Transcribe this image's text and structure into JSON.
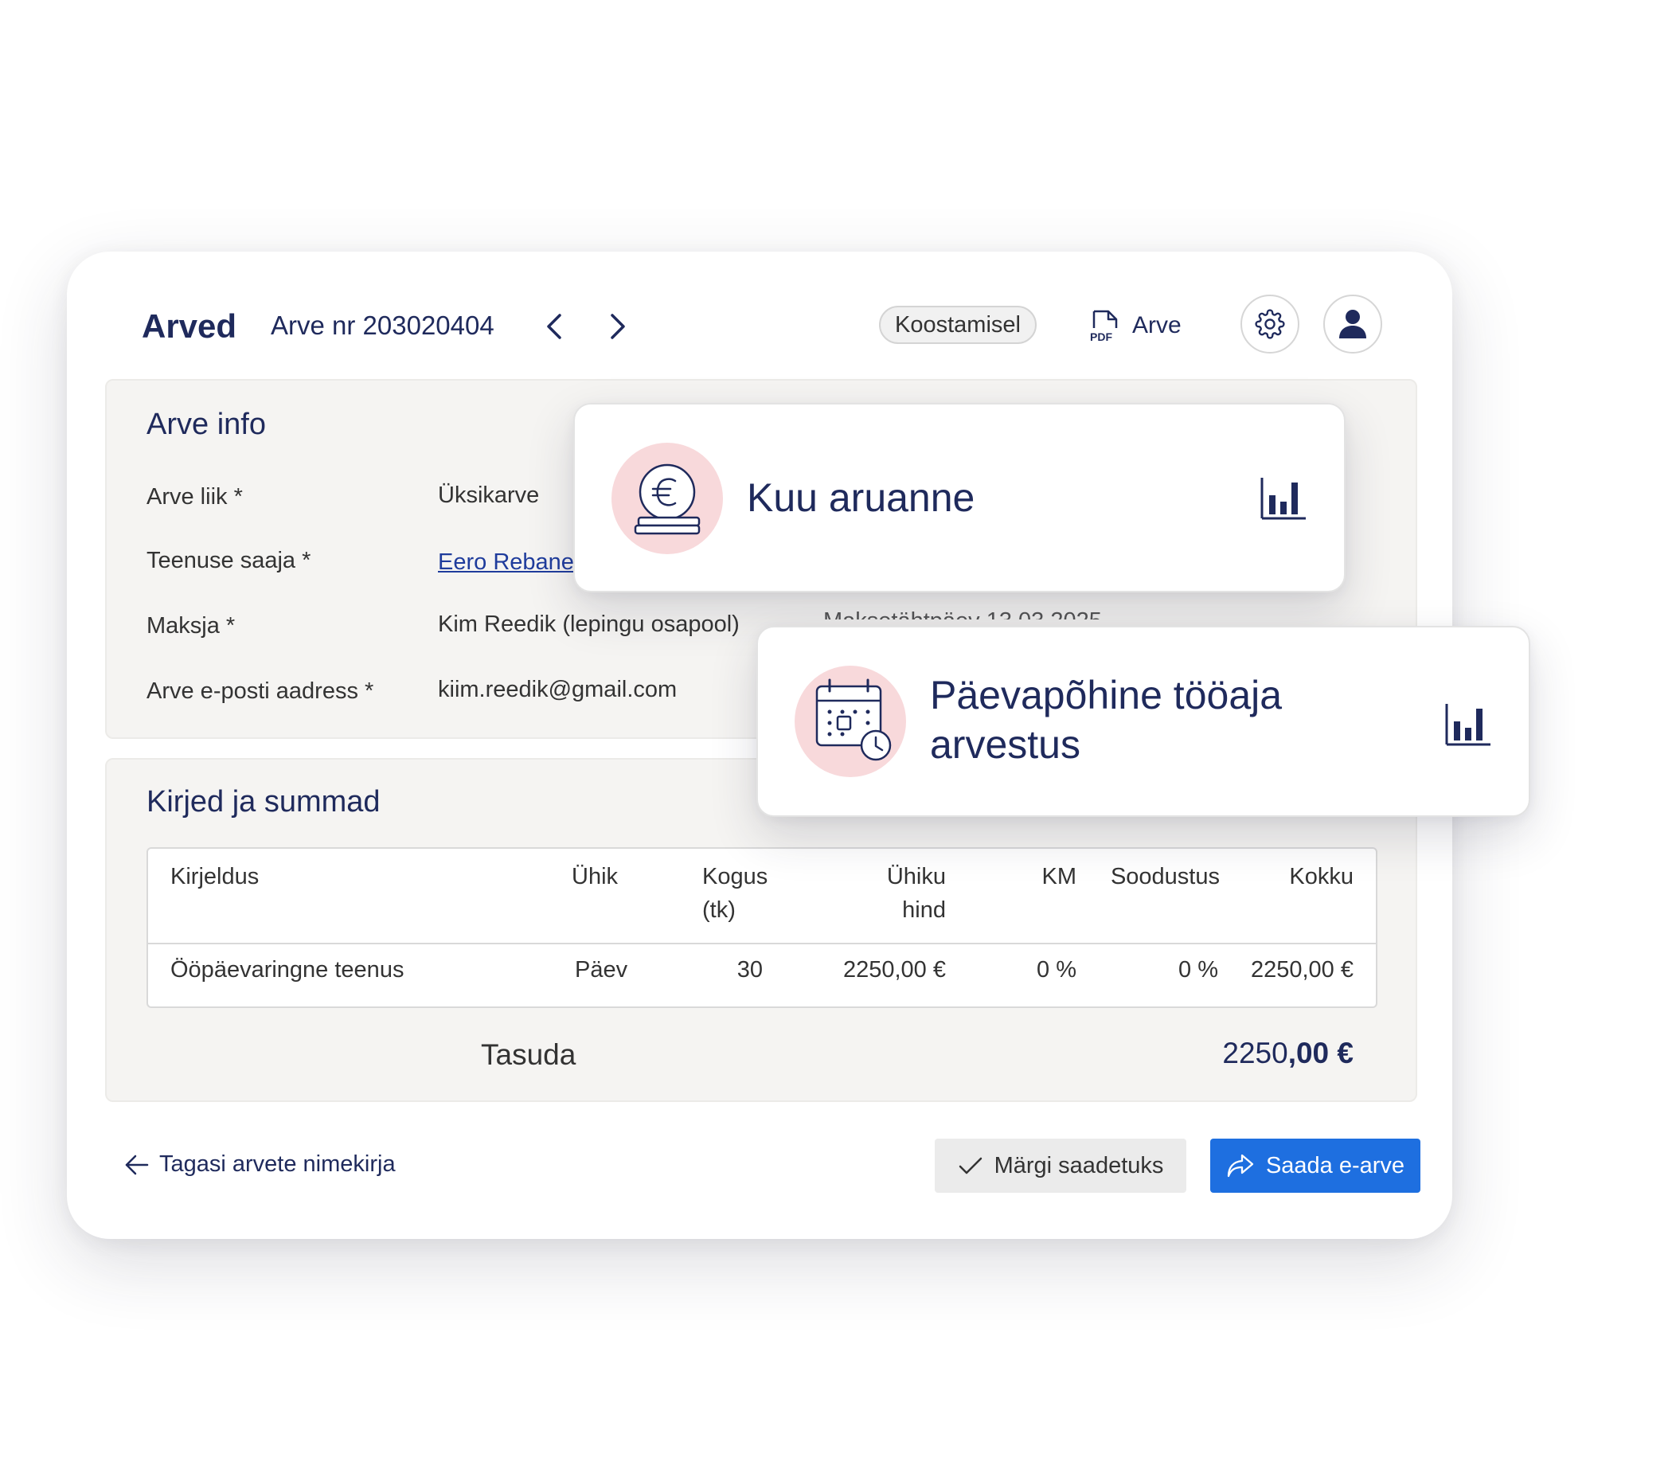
{
  "header": {
    "title": "Arved",
    "invoice_number": "Arve nr 203020404",
    "status": "Koostamisel",
    "pdf_badge": "PDF",
    "pdf_label": "Arve"
  },
  "invoice_info": {
    "title": "Arve info",
    "fields": [
      {
        "label": "Arve liik *",
        "value": "Üksikarve"
      },
      {
        "label": "Teenuse saaja *",
        "value": "Eero Rebane"
      },
      {
        "label": "Maksja *",
        "value": "Kim Reedik (lepingu osapool)"
      },
      {
        "label": "Arve e-posti aadress *",
        "value": "kiim.reedik@gmail.com"
      }
    ],
    "partial_hidden_text": "Maksetähtpäev 13.03.2025"
  },
  "items": {
    "title": "Kirjed ja summad",
    "columns": [
      "Kirjeldus",
      "Ühik",
      "Kogus",
      "(tk)",
      "Ühiku",
      "hind",
      "KM",
      "Soodustus",
      "Kokku"
    ],
    "rows": [
      {
        "description": "Ööpäevaringne teenus",
        "unit": "Päev",
        "quantity": "30",
        "unit_price": "2250,00 €",
        "vat": "0 %",
        "discount": "0 %",
        "total": "2250,00 €"
      }
    ],
    "total_label": "Tasuda",
    "total_main": "2250",
    "total_decimal": ",00 €"
  },
  "footer": {
    "back_label": "Tagasi arvete nimekirja",
    "mark_sent_label": "Märgi saadetuks",
    "send_label": "Saada e-arve"
  },
  "cards": {
    "monthly_report": "Kuu aruanne",
    "daily_time": "Päevapõhine tööaja arvestus"
  },
  "colors": {
    "navy": "#1f2a5c",
    "primary_blue": "#1e6fe0",
    "icon_pink": "#f8d9db",
    "panel_bg": "#f5f4f2"
  }
}
